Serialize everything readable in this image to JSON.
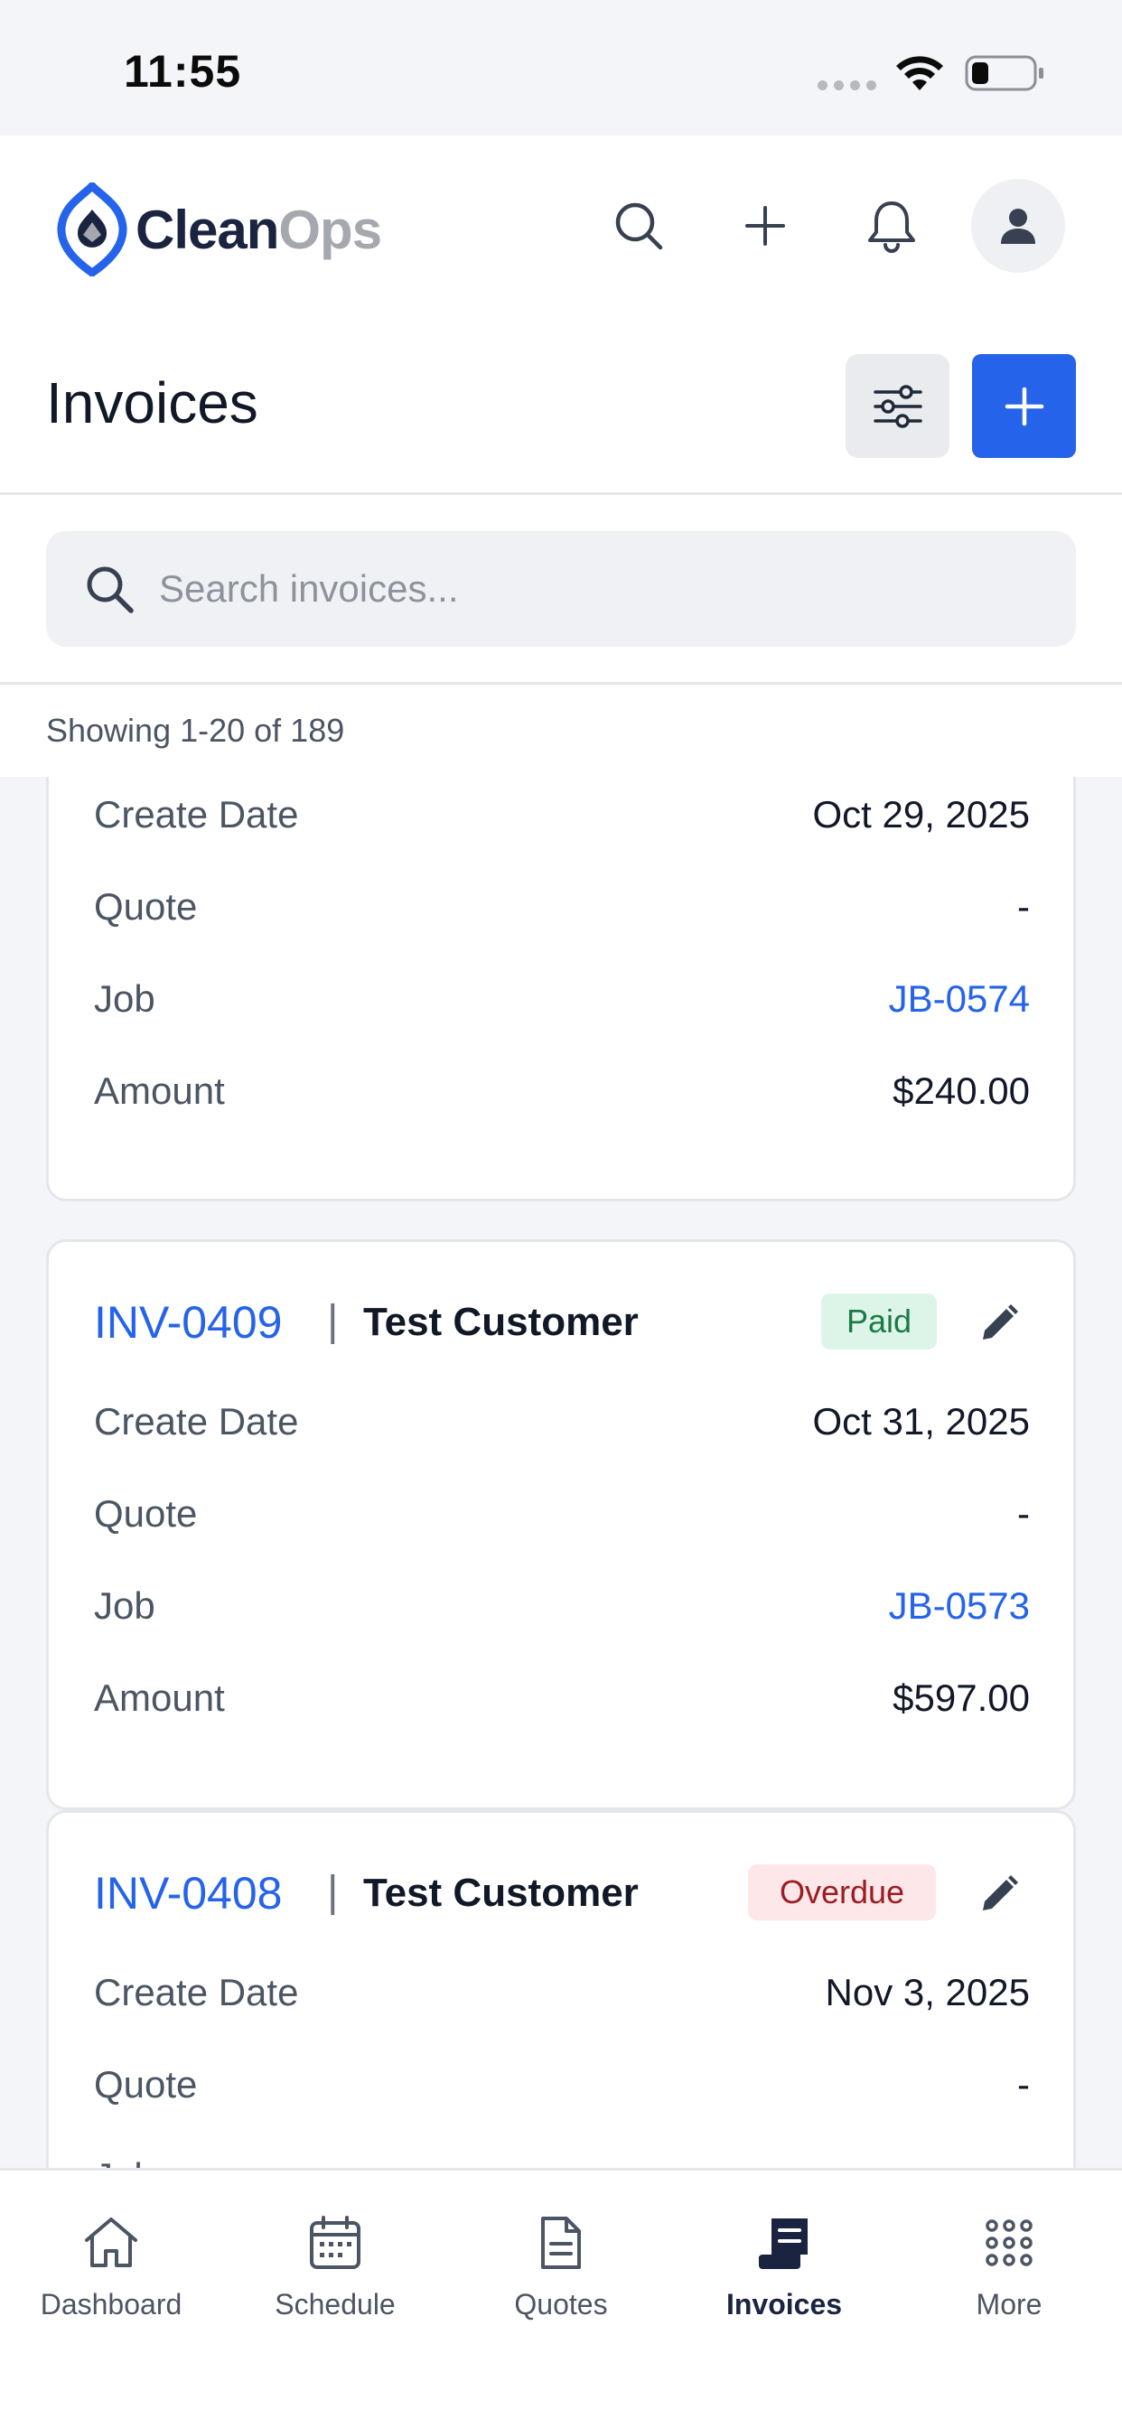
{
  "status_bar": {
    "time": "11:55"
  },
  "header": {
    "brand_part1": "Clean",
    "brand_part2": "Ops"
  },
  "page": {
    "title": "Invoices"
  },
  "search": {
    "placeholder": "Search invoices...",
    "value": ""
  },
  "list": {
    "showing": "Showing 1-20 of 189",
    "field_labels": {
      "create_date": "Create Date",
      "quote": "Quote",
      "job": "Job",
      "amount": "Amount"
    },
    "invoices": [
      {
        "id": "",
        "customer": "",
        "status": "",
        "create_date": "Oct 29, 2025",
        "quote": "-",
        "job": "JB-0574",
        "amount": "$240.00"
      },
      {
        "id": "INV-0409",
        "customer": "Test Customer",
        "status": "Paid",
        "create_date": "Oct 31, 2025",
        "quote": "-",
        "job": "JB-0573",
        "amount": "$597.00"
      },
      {
        "id": "INV-0408",
        "customer": "Test Customer",
        "status": "Overdue",
        "create_date": "Nov 3, 2025",
        "quote": "-",
        "job": "",
        "amount": ""
      }
    ]
  },
  "bottom_nav": {
    "items": [
      {
        "label": "Dashboard",
        "icon": "home-icon"
      },
      {
        "label": "Schedule",
        "icon": "calendar-icon"
      },
      {
        "label": "Quotes",
        "icon": "document-icon"
      },
      {
        "label": "Invoices",
        "icon": "receipt-icon",
        "active": true
      },
      {
        "label": "More",
        "icon": "grid-dots-icon"
      }
    ]
  },
  "colors": {
    "primary": "#2563eb",
    "brand_dark": "#1a2340",
    "paid_bg": "#dcf5e8",
    "paid_text": "#1b7a45",
    "overdue_bg": "#fde7e8",
    "overdue_text": "#9b1c24"
  }
}
